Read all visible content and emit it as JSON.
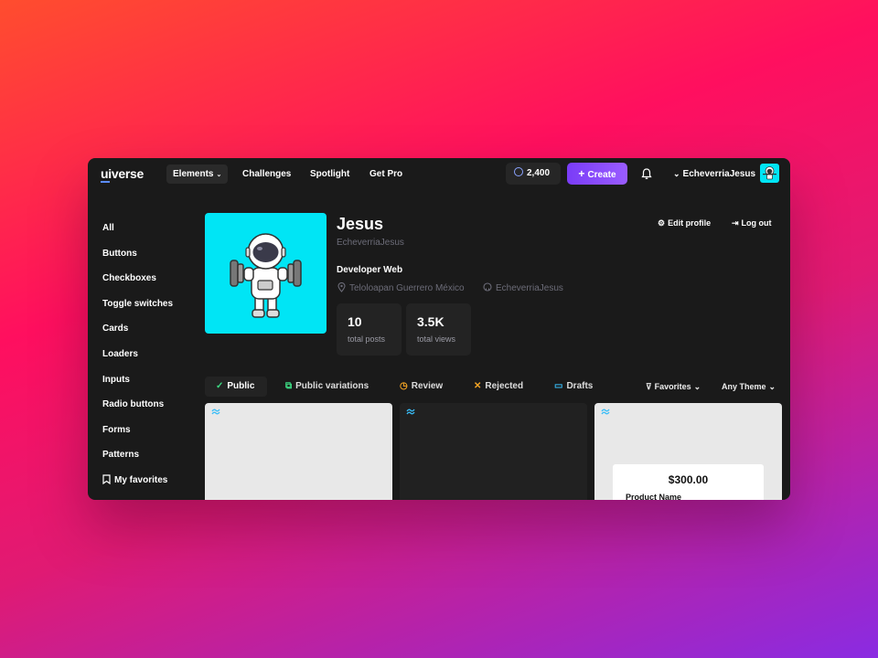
{
  "nav": {
    "logo_ui": "ui",
    "logo_verse": "verse",
    "items": [
      "Elements",
      "Challenges",
      "Spotlight",
      "Get Pro"
    ],
    "coins": "2,400",
    "create_label": "Create",
    "username": "EcheverriaJesus"
  },
  "sidebar": {
    "items": [
      "All",
      "Buttons",
      "Checkboxes",
      "Toggle switches",
      "Cards",
      "Loaders",
      "Inputs",
      "Radio buttons",
      "Forms",
      "Patterns"
    ],
    "favorites": "My favorites"
  },
  "profile": {
    "name": "Jesus",
    "handle": "EcheverriaJesus",
    "role": "Developer Web",
    "location": "Teloloapan Guerrero México",
    "github": "EcheverriaJesus",
    "stats": [
      {
        "num": "10",
        "label": "total posts"
      },
      {
        "num": "3.5K",
        "label": "total views"
      }
    ],
    "edit_label": "Edit profile",
    "logout_label": "Log out"
  },
  "tabs": [
    "Public",
    "Public variations",
    "Review",
    "Rejected",
    "Drafts"
  ],
  "filters": {
    "favorites": "Favorites",
    "theme": "Any Theme"
  },
  "cards": [
    {
      "bg": "#e8e8e8"
    },
    {
      "bg": "#212121"
    },
    {
      "bg": "#e8e8e8",
      "price": "$300.00",
      "product": "Product Name"
    }
  ],
  "colors": {
    "accent_green": "#3ddc84",
    "create": "#7a3cf7",
    "avatar_bg": "#00e5f5",
    "tailwind": "#38bdf8"
  }
}
